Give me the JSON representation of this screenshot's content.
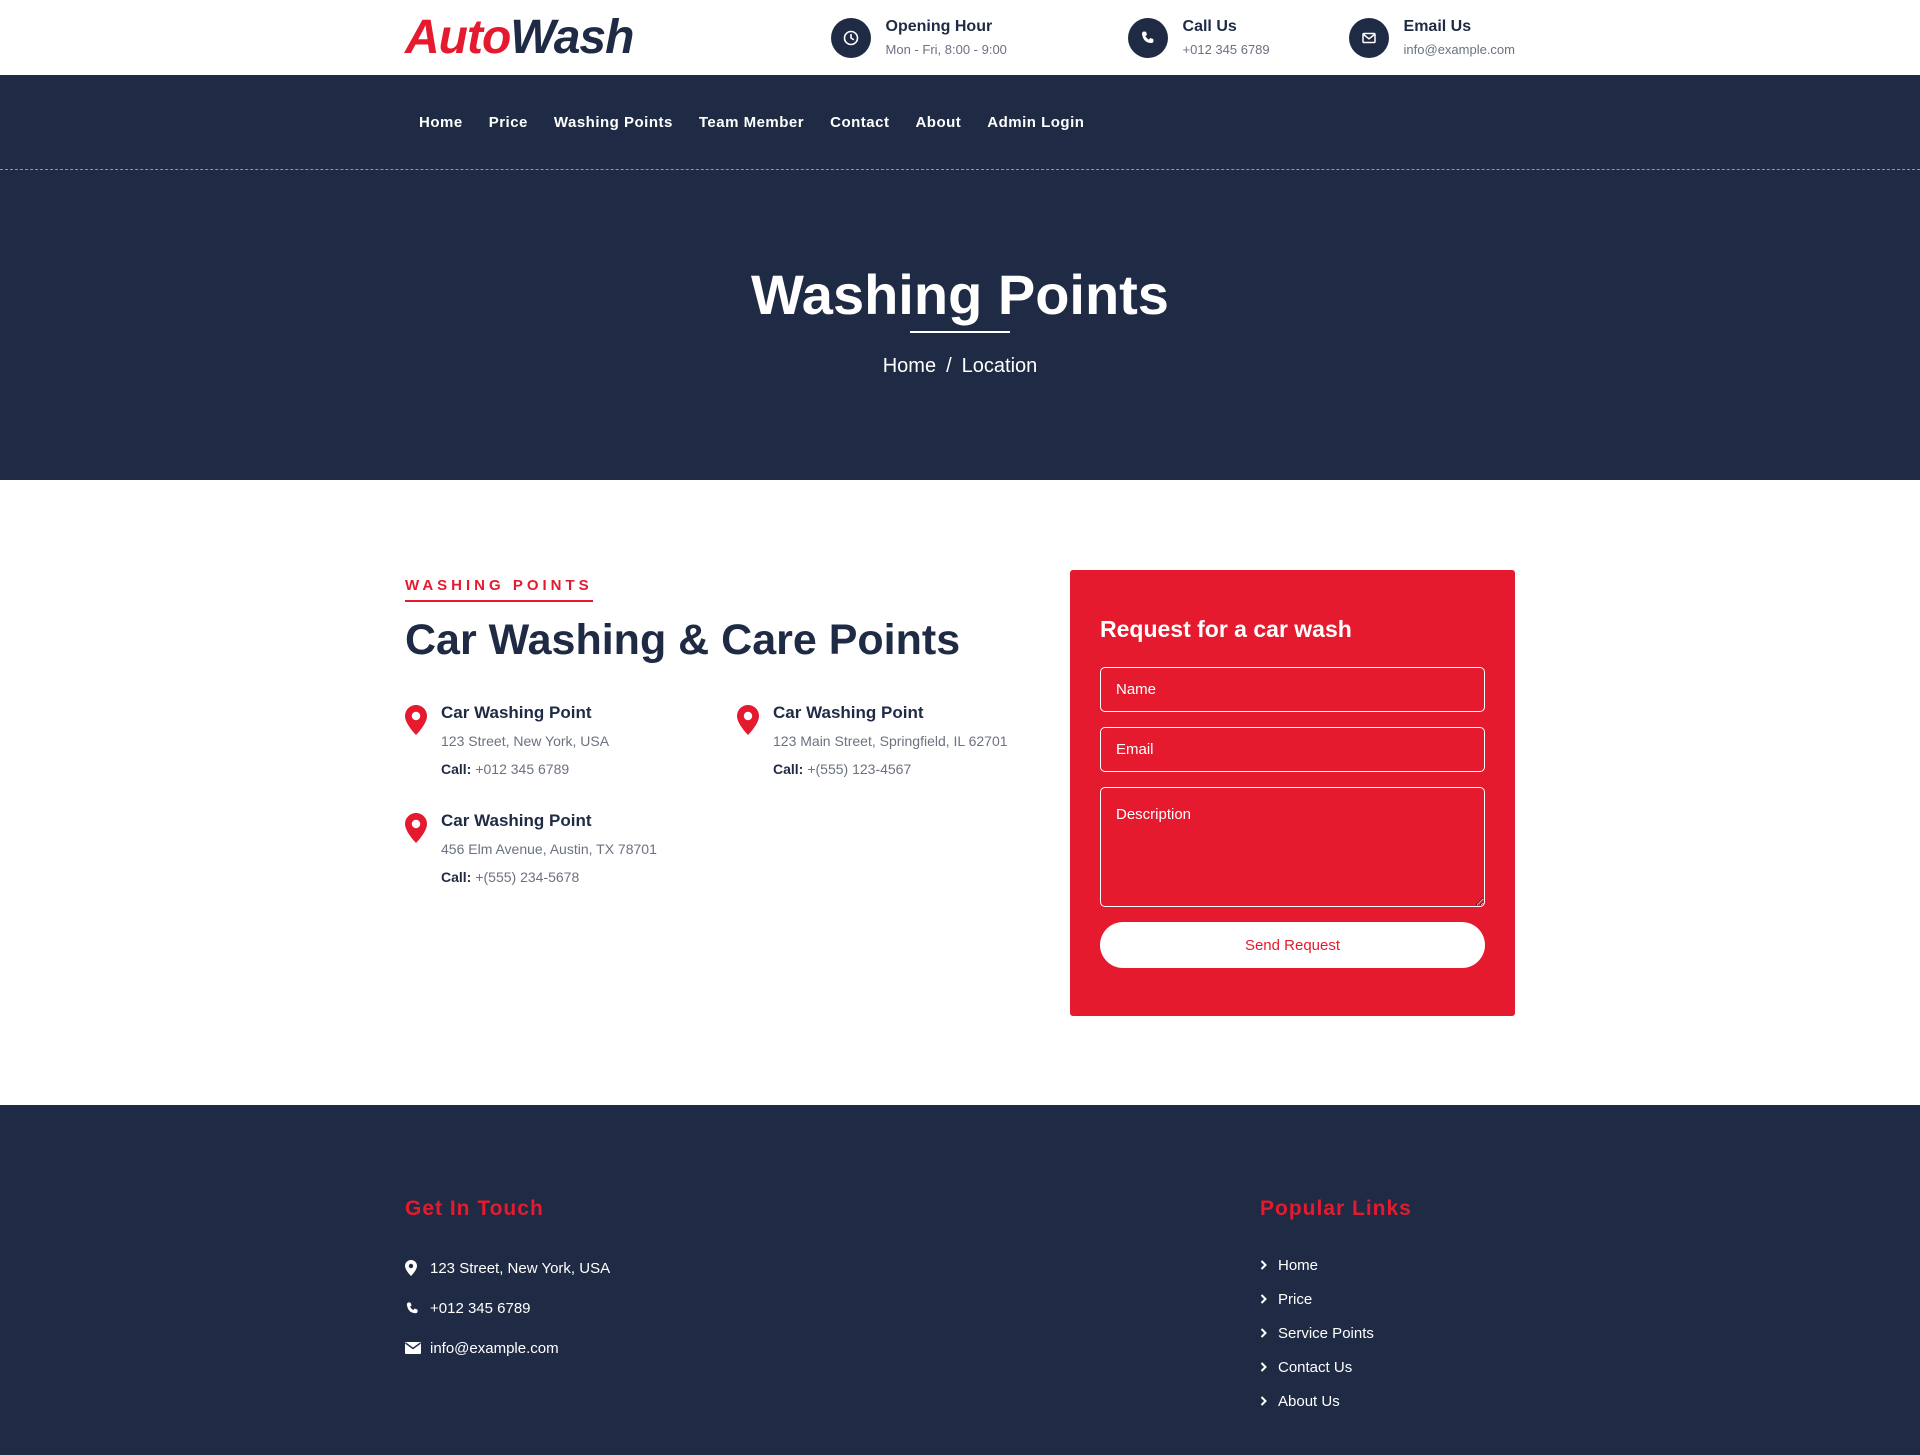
{
  "brand": {
    "part1": "Auto",
    "part2": "Wash"
  },
  "contacts": [
    {
      "icon": "clock-icon",
      "title": "Opening Hour",
      "value": "Mon - Fri, 8:00 - 9:00"
    },
    {
      "icon": "phone-icon",
      "title": "Call Us",
      "value": "+012 345 6789"
    },
    {
      "icon": "envelope-icon",
      "title": "Email Us",
      "value": "info@example.com"
    }
  ],
  "nav": [
    "Home",
    "Price",
    "Washing Points",
    "Team Member",
    "Contact",
    "About",
    "Admin Login"
  ],
  "hero": {
    "title": "Washing Points",
    "breadcrumb": {
      "home": "Home",
      "separator": "/",
      "current": "Location"
    }
  },
  "section": {
    "eyebrow": "WASHING POINTS",
    "title": "Car Washing & Care Points",
    "call_label": "Call:",
    "points": [
      {
        "name": "Car Washing Point",
        "address": "123 Street, New York, USA",
        "phone": "+012 345 6789"
      },
      {
        "name": "Car Washing Point",
        "address": "123 Main Street, Springfield, IL 62701",
        "phone": "+(555) 123-4567"
      },
      {
        "name": "Car Washing Point",
        "address": "456 Elm Avenue, Austin, TX 78701",
        "phone": "+(555) 234-5678"
      }
    ]
  },
  "form": {
    "title": "Request for a car wash",
    "name_placeholder": "Name",
    "email_placeholder": "Email",
    "description_placeholder": "Description",
    "submit_label": "Send Request"
  },
  "footer": {
    "touch_title": "Get In Touch",
    "address": "123 Street, New York, USA",
    "phone": "+012 345 6789",
    "email": "info@example.com",
    "links_title": "Popular Links",
    "links": [
      "Home",
      "Price",
      "Service Points",
      "Contact Us",
      "About Us"
    ]
  },
  "colors": {
    "accent": "#e51a2e",
    "navy": "#1f2a44"
  }
}
